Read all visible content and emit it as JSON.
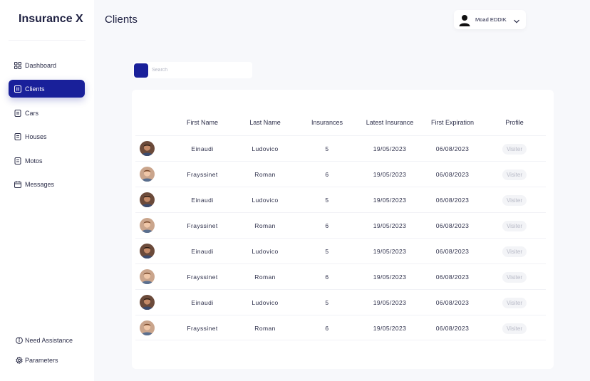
{
  "app": {
    "brand": "Insurance X"
  },
  "sidebar": {
    "items": [
      {
        "label": "Dashboard",
        "icon": "grid-icon",
        "active": false
      },
      {
        "label": "Clients",
        "icon": "columns-icon",
        "active": true
      },
      {
        "label": "Cars",
        "icon": "document-icon",
        "active": false
      },
      {
        "label": "Houses",
        "icon": "document-icon",
        "active": false
      },
      {
        "label": "Motos",
        "icon": "document-icon",
        "active": false
      },
      {
        "label": "Messages",
        "icon": "calendar-icon",
        "active": false
      }
    ],
    "bottom": [
      {
        "label": "Need Assistance",
        "icon": "info-icon"
      },
      {
        "label": "Parameters",
        "icon": "gear-icon"
      }
    ]
  },
  "header": {
    "title": "Clients",
    "user": {
      "name": "Moad EDDIK",
      "icon": "user-avatar-icon"
    }
  },
  "search": {
    "placeholder": "Search"
  },
  "table": {
    "columns": [
      "",
      "First Name",
      "Last Name",
      "Insurances",
      "Latest Insurance",
      "First Expiration",
      "Profile"
    ],
    "rows": [
      {
        "first": "Einaudi",
        "last": "Ludovico",
        "insurances": "5",
        "latest": "19/05/2023",
        "expiration": "06/08/2023",
        "profile": "Visiter",
        "avatar": "dark"
      },
      {
        "first": "Frayssinet",
        "last": "Roman",
        "insurances": "6",
        "latest": "19/05/2023",
        "expiration": "06/08/2023",
        "profile": "Visiter",
        "avatar": "light"
      },
      {
        "first": "Einaudi",
        "last": "Ludovico",
        "insurances": "5",
        "latest": "19/05/2023",
        "expiration": "06/08/2023",
        "profile": "Visiter",
        "avatar": "dark"
      },
      {
        "first": "Frayssinet",
        "last": "Roman",
        "insurances": "6",
        "latest": "19/05/2023",
        "expiration": "06/08/2023",
        "profile": "Visiter",
        "avatar": "light"
      },
      {
        "first": "Einaudi",
        "last": "Ludovico",
        "insurances": "5",
        "latest": "19/05/2023",
        "expiration": "06/08/2023",
        "profile": "Visiter",
        "avatar": "dark"
      },
      {
        "first": "Frayssinet",
        "last": "Roman",
        "insurances": "6",
        "latest": "19/05/2023",
        "expiration": "06/08/2023",
        "profile": "Visiter",
        "avatar": "light"
      },
      {
        "first": "Einaudi",
        "last": "Ludovico",
        "insurances": "5",
        "latest": "19/05/2023",
        "expiration": "06/08/2023",
        "profile": "Visiter",
        "avatar": "dark"
      },
      {
        "first": "Frayssinet",
        "last": "Roman",
        "insurances": "6",
        "latest": "19/05/2023",
        "expiration": "06/08/2023",
        "profile": "Visiter",
        "avatar": "light"
      }
    ]
  },
  "colors": {
    "accent": "#19209a",
    "background": "#f7f8fb",
    "text": "#2d2f4a"
  }
}
